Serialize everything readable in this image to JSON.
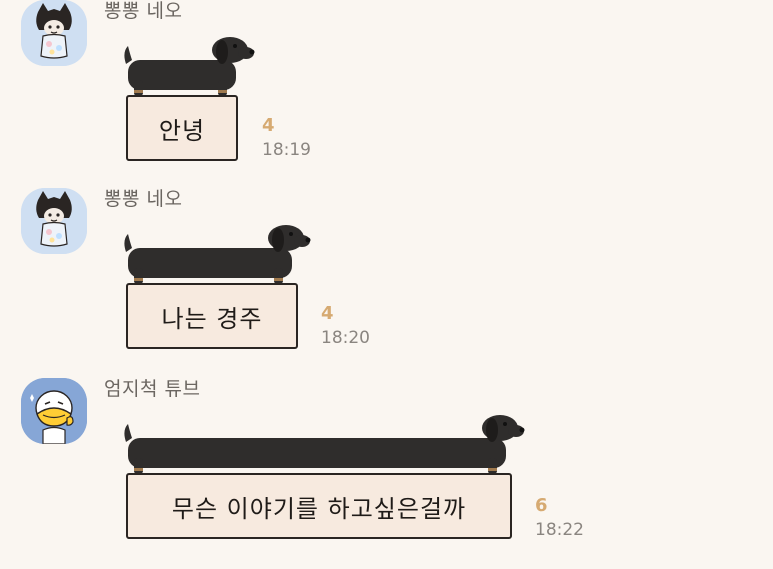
{
  "messages": [
    {
      "sender": "뽕뽕 네오",
      "avatar_icon": "neo-character-icon",
      "text": "안녕",
      "unread": "4",
      "time": "18:19"
    },
    {
      "sender": "뽕뽕 네오",
      "avatar_icon": "neo-character-icon",
      "text": "나는 경주",
      "unread": "4",
      "time": "18:20"
    },
    {
      "sender": "엄지척 튜브",
      "avatar_icon": "tube-duck-character-icon",
      "text": "무슨 이야기를 하고싶은걸까",
      "unread": "6",
      "time": "18:22"
    }
  ],
  "colors": {
    "background": "#faf6f1",
    "bubble": "#f7eadf",
    "bubble_border": "#2a2522",
    "unread": "#d6aa72",
    "time": "#8a8580",
    "sender": "#6b6661",
    "dog": "#2f2d2c",
    "neo_avatar_bg": "#cfdff2",
    "tube_avatar_bg": "#86a6d6"
  }
}
